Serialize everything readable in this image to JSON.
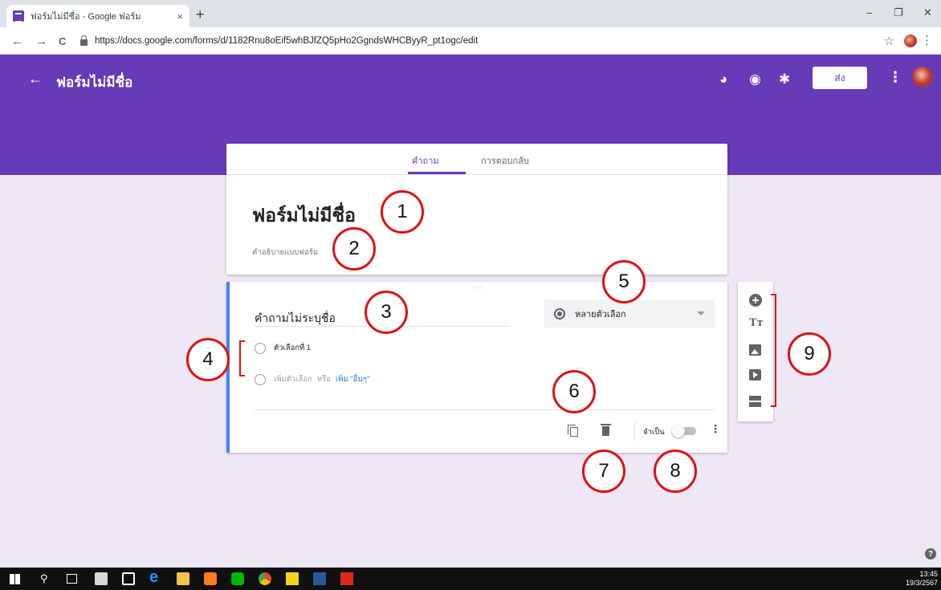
{
  "browser": {
    "tab_title": "ฟอร์มไม่มีชื่อ - Google ฟอร์ม",
    "tab_close": "×",
    "new_tab": "+",
    "window_minimize": "–",
    "window_restore": "❐",
    "window_close": "✕",
    "nav_back": "←",
    "nav_forward": "→",
    "nav_reload": "C",
    "url": "https://docs.google.com/forms/d/1182Rnu8oEif5whBJfZQ5pHo2GgndsWHCByyR_pt1ogc/edit",
    "bookmark": "☆",
    "menu": "⋮"
  },
  "header": {
    "back": "←",
    "title": "ฟอร์มไม่มีชื่อ",
    "send_label": "ส่ง",
    "more": "⋮",
    "palette_icon": "◕",
    "preview_icon": "◉",
    "settings_icon": "✱"
  },
  "form_tabs": {
    "questions": "คำถาม",
    "responses": "การตอบกลับ"
  },
  "form": {
    "title": "ฟอร์มไม่มีชื่อ",
    "description_placeholder": "คำอธิบายแบบฟอร์ม"
  },
  "question": {
    "drag_handle": ":::",
    "title": "คำถามไม่ระบุชื่อ",
    "type": "หลายตัวเลือก",
    "option_1": "ตัวเลือกที่ 1",
    "add_option": "เพิ่มตัวเลือก",
    "or": "หรือ",
    "add_other": "เพิ่ม \"อื่นๆ\"",
    "required_label": "จำเป็น",
    "required": false,
    "more": "⋮"
  },
  "toolbar": {
    "title_icon": "Tт",
    "items": [
      "add-question",
      "add-title",
      "add-image",
      "add-video",
      "add-section"
    ]
  },
  "annotations": [
    "1",
    "2",
    "3",
    "4",
    "5",
    "6",
    "7",
    "8",
    "9"
  ],
  "footer": {
    "help": "?",
    "clock_time": "13:45",
    "clock_date": "19/3/2567"
  },
  "colors": {
    "accent": "#673ab7",
    "page_bg": "#ede7f6",
    "annotation": "#e01010",
    "question_focus": "#4285f4"
  }
}
